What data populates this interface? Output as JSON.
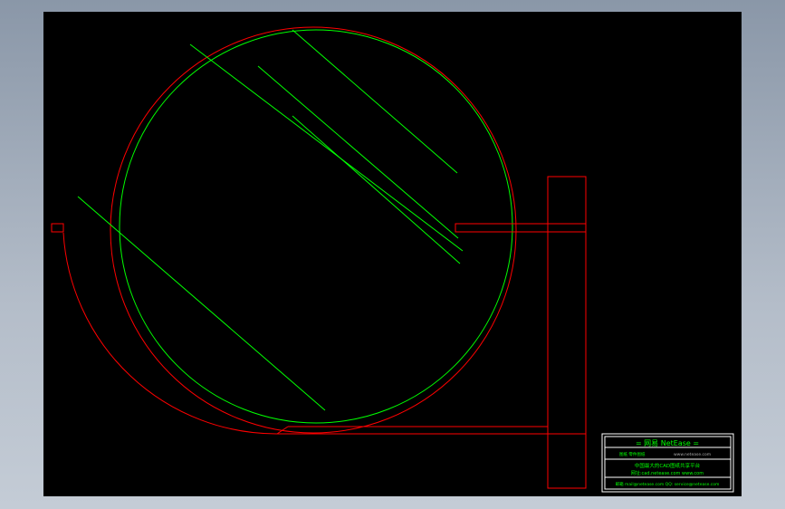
{
  "viewport": {
    "background": "#000000",
    "frame_color": "#ff0000",
    "hatch_color": "#00ff00"
  },
  "title_block": {
    "header": "= 网易 NetEase =",
    "line1_left": "图纸 零件图纸",
    "line1_right": "www.netease.com",
    "line2": "中国最大的CAD图纸共享平台",
    "line3": "网址:cad.netease.com www.com",
    "line4": "邮箱 mail@netease.com  QQ: service@netease.com"
  }
}
